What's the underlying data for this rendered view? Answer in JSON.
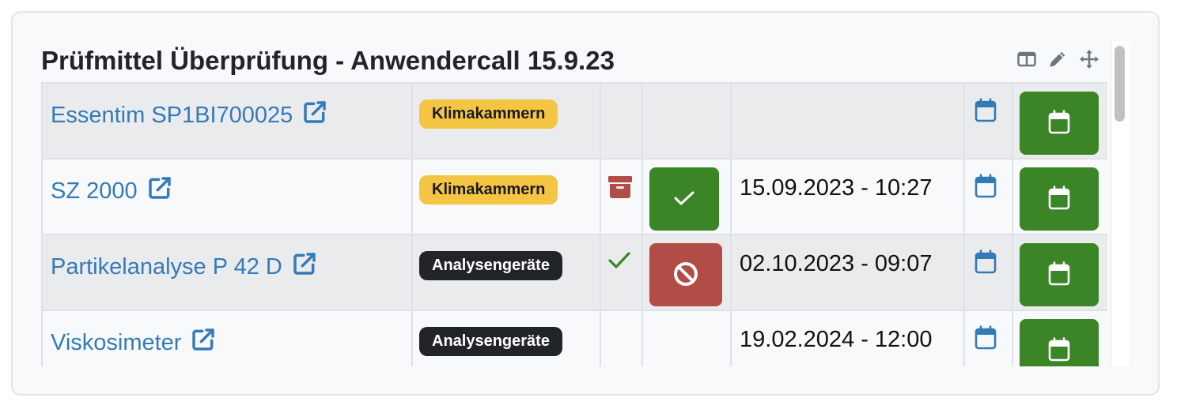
{
  "panel": {
    "title": "Prüfmittel Überprüfung - Anwendercall 15.9.23",
    "tool_icons": [
      "columns-icon",
      "pencil-icon",
      "move-icon"
    ]
  },
  "colors": {
    "link": "#337ab7",
    "success": "#3c8527",
    "danger": "#b24c46",
    "badge_yellow": "#f4c542",
    "badge_dark": "#212529"
  },
  "rows": [
    {
      "name": "Essentim SP1BI700025",
      "category": "Klimakammern",
      "category_style": "yellow",
      "status_icon": "",
      "action": "",
      "date": ""
    },
    {
      "name": "SZ 2000",
      "category": "Klimakammern",
      "category_style": "yellow",
      "status_icon": "archive-icon",
      "action": "confirm",
      "date": "15.09.2023 - 10:27"
    },
    {
      "name": "Partikelanalyse P 42 D",
      "category": "Analysengeräte",
      "category_style": "dark",
      "status_icon": "check-icon",
      "action": "cancel",
      "date": "02.10.2023 - 09:07"
    },
    {
      "name": "Viskosimeter",
      "category": "Analysengeräte",
      "category_style": "dark",
      "status_icon": "",
      "action": "",
      "date": "19.02.2024 - 12:00"
    }
  ]
}
